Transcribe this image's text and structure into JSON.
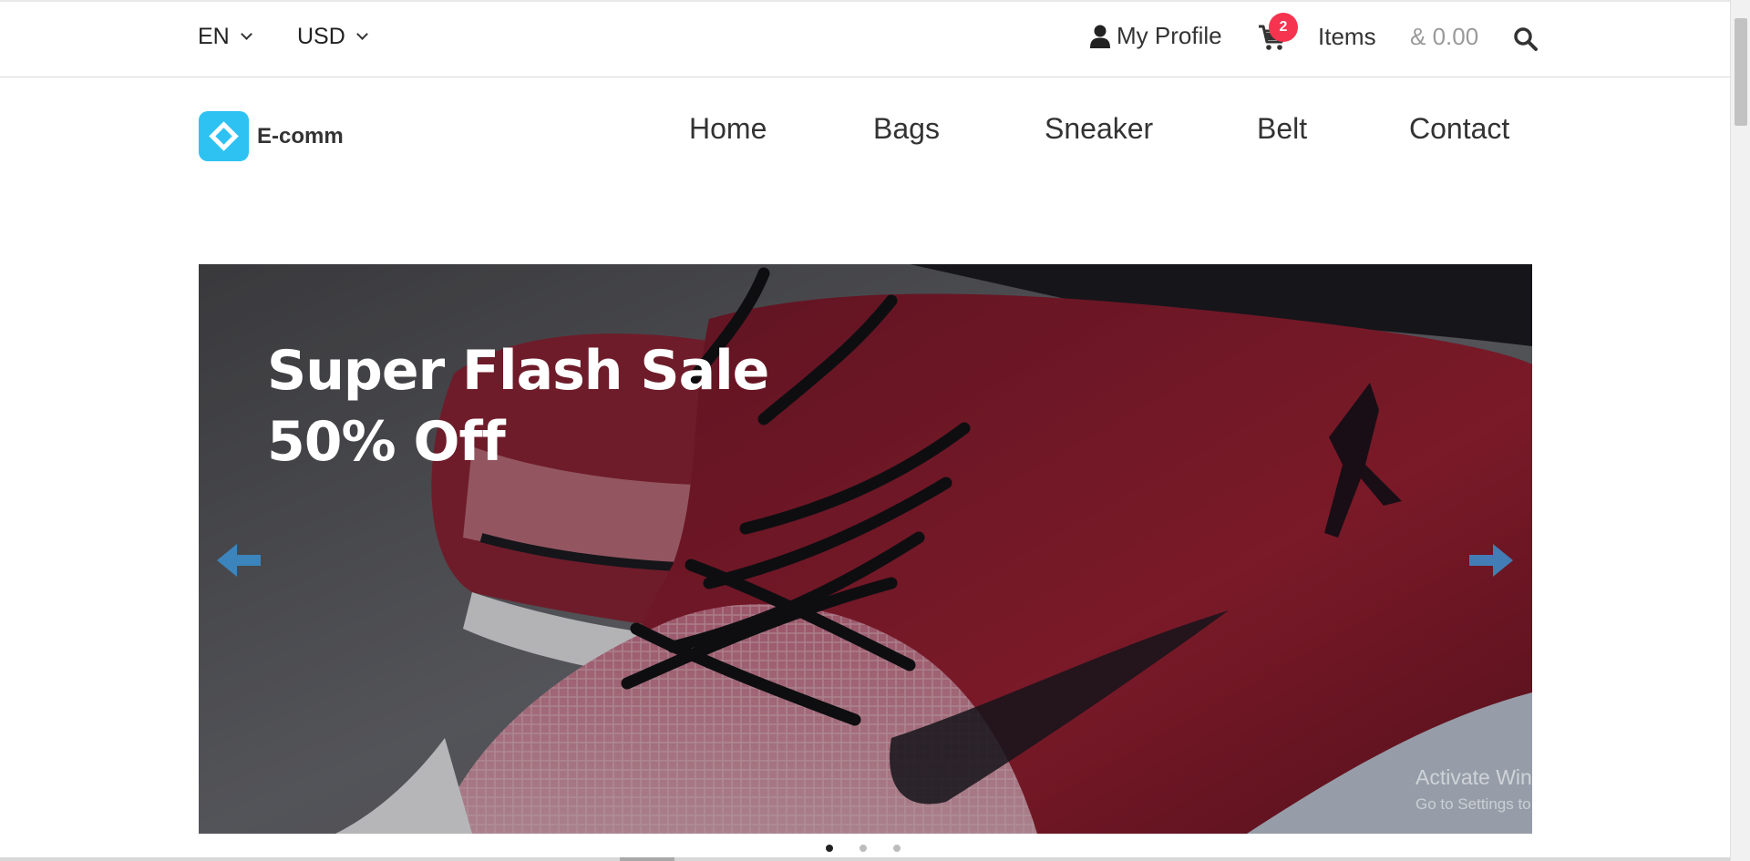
{
  "topbar": {
    "language": "EN",
    "currency": "USD",
    "profile_label": "My Profile",
    "cart_count": "2",
    "items_label": "Items",
    "cart_total": "& 0.00"
  },
  "brand": {
    "name": "E-comm",
    "logo_color": "#2ec2f3"
  },
  "nav": {
    "items": [
      "Home",
      "Bags",
      "Sneaker",
      "Belt",
      "Contact"
    ]
  },
  "hero": {
    "line1": "Super Flash Sale",
    "line2": "50% Off",
    "active_slide": 1,
    "slide_count": 3
  },
  "icons": {
    "profile": "user-icon",
    "cart": "cart-icon",
    "search": "search-icon",
    "prev": "arrow-left-icon",
    "next": "arrow-right-icon"
  },
  "watermark": {
    "title": "Activate Windows",
    "subtitle": "Go to Settings to activate Windows."
  }
}
